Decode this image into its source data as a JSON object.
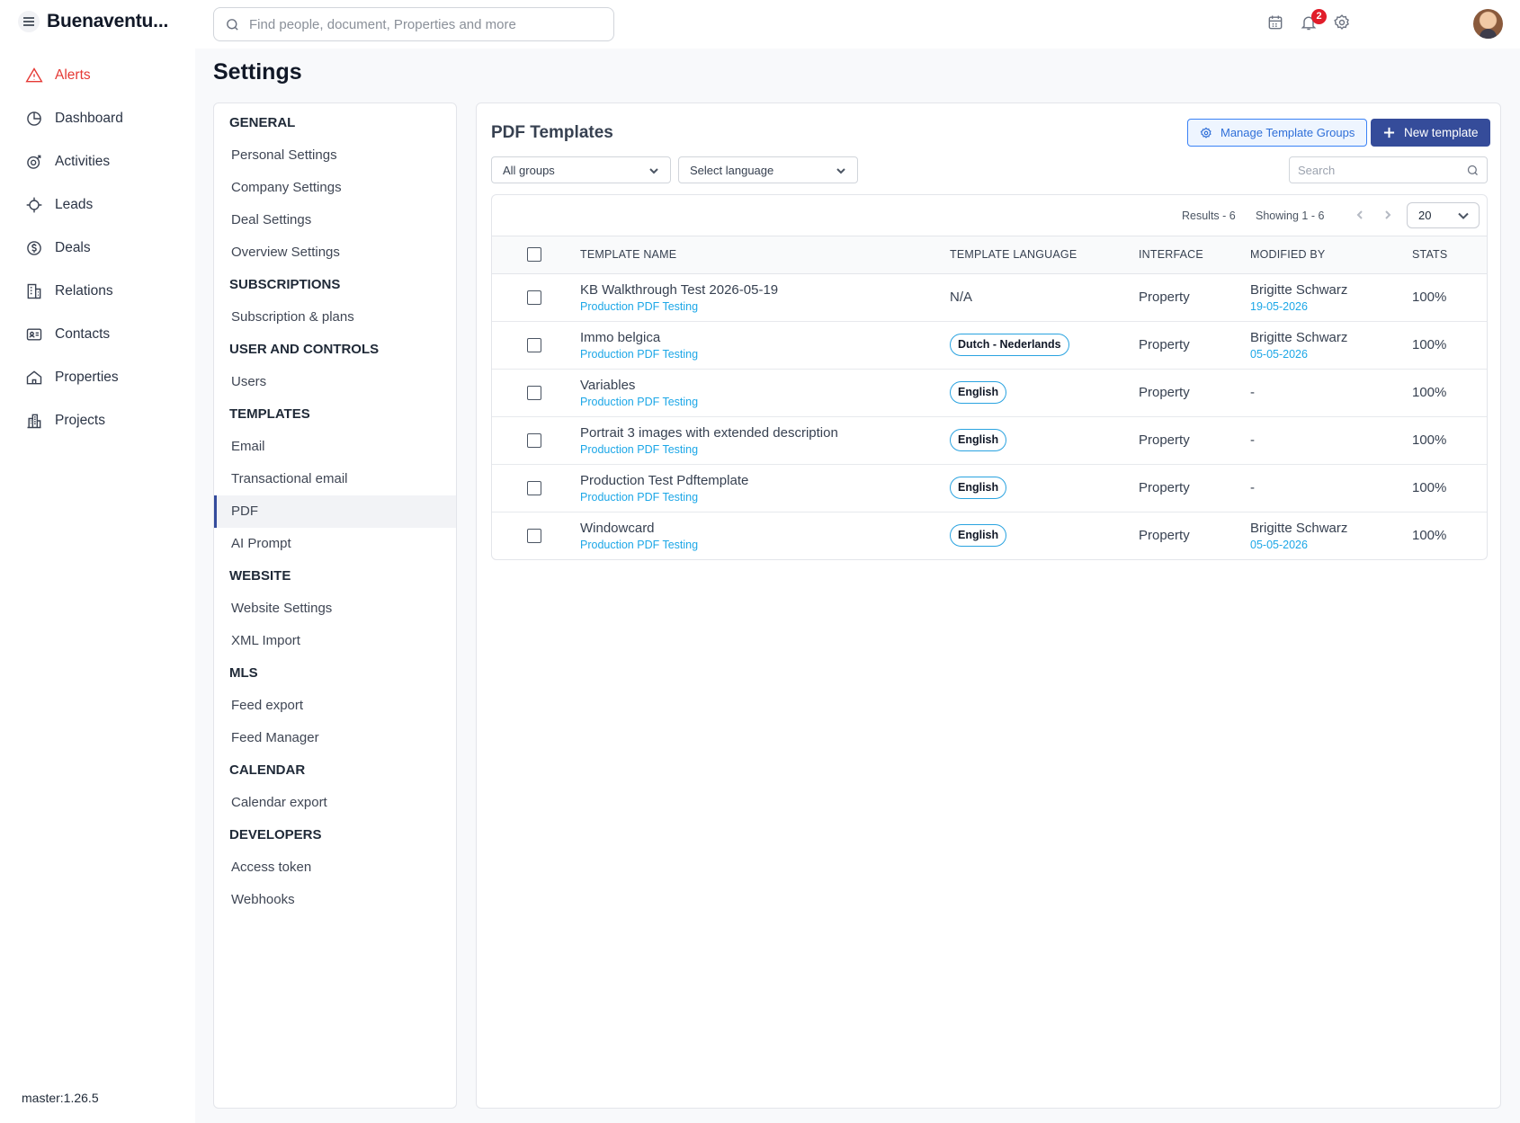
{
  "app": {
    "brand": "Buenaventu...",
    "version": "master:1.26.5"
  },
  "nav": [
    {
      "label": "Alerts",
      "icon": "alert-icon",
      "active": true
    },
    {
      "label": "Dashboard",
      "icon": "dashboard-icon"
    },
    {
      "label": "Activities",
      "icon": "activities-icon"
    },
    {
      "label": "Leads",
      "icon": "leads-icon"
    },
    {
      "label": "Deals",
      "icon": "deals-icon"
    },
    {
      "label": "Relations",
      "icon": "relations-icon"
    },
    {
      "label": "Contacts",
      "icon": "contacts-icon"
    },
    {
      "label": "Properties",
      "icon": "home-icon"
    },
    {
      "label": "Projects",
      "icon": "projects-icon"
    }
  ],
  "topbar": {
    "search_placeholder": "Find people, document, Properties and more",
    "notification_count": "2"
  },
  "page": {
    "title": "Settings"
  },
  "settings_menu": [
    {
      "heading": "GENERAL",
      "items": [
        "Personal Settings",
        "Company Settings",
        "Deal Settings",
        "Overview Settings"
      ]
    },
    {
      "heading": "SUBSCRIPTIONS",
      "items": [
        "Subscription & plans"
      ]
    },
    {
      "heading": "USER AND CONTROLS",
      "items": [
        "Users"
      ]
    },
    {
      "heading": "TEMPLATES",
      "items": [
        "Email",
        "Transactional email",
        "PDF",
        "AI Prompt"
      ]
    },
    {
      "heading": "WEBSITE",
      "items": [
        "Website Settings",
        "XML Import"
      ]
    },
    {
      "heading": "MLS",
      "items": [
        "Feed export",
        "Feed Manager"
      ]
    },
    {
      "heading": "CALENDAR",
      "items": [
        "Calendar export"
      ]
    },
    {
      "heading": "DEVELOPERS",
      "items": [
        "Access token",
        "Webhooks"
      ]
    }
  ],
  "settings_active": "PDF",
  "panel": {
    "title": "PDF Templates",
    "manage_label": "Manage Template Groups",
    "new_label": "New template",
    "group_select": "All groups",
    "language_select": "Select language",
    "search_placeholder": "Search",
    "results": "Results - 6",
    "showing": "Showing 1 - 6",
    "per_page": "20",
    "columns": [
      "TEMPLATE NAME",
      "TEMPLATE LANGUAGE",
      "INTERFACE",
      "MODIFIED BY",
      "STATS"
    ],
    "rows": [
      {
        "name": "KB Walkthrough Test 2026-05-19",
        "group": "Production PDF Testing",
        "language": "N/A",
        "language_pill": false,
        "interface": "Property",
        "modified_by": "Brigitte Schwarz",
        "modified_date": "19-05-2026",
        "stats": "100%"
      },
      {
        "name": "Immo belgica",
        "group": "Production PDF Testing",
        "language": "Dutch - Nederlands",
        "language_pill": true,
        "interface": "Property",
        "modified_by": "Brigitte Schwarz",
        "modified_date": "05-05-2026",
        "stats": "100%"
      },
      {
        "name": "Variables",
        "group": "Production PDF Testing",
        "language": "English",
        "language_pill": true,
        "interface": "Property",
        "modified_by": "-",
        "modified_date": "",
        "stats": "100%"
      },
      {
        "name": "Portrait 3 images with extended description",
        "group": "Production PDF Testing",
        "language": "English",
        "language_pill": true,
        "interface": "Property",
        "modified_by": "-",
        "modified_date": "",
        "stats": "100%"
      },
      {
        "name": "Production Test Pdftemplate",
        "group": "Production PDF Testing",
        "language": "English",
        "language_pill": true,
        "interface": "Property",
        "modified_by": "-",
        "modified_date": "",
        "stats": "100%"
      },
      {
        "name": "Windowcard",
        "group": "Production PDF Testing",
        "language": "English",
        "language_pill": true,
        "interface": "Property",
        "modified_by": "Brigitte Schwarz",
        "modified_date": "05-05-2026",
        "stats": "100%"
      }
    ]
  },
  "colors": {
    "accent": "#354c9a",
    "alert": "#e53935",
    "link": "#1ca7e7",
    "badge": "#e11d2a"
  }
}
